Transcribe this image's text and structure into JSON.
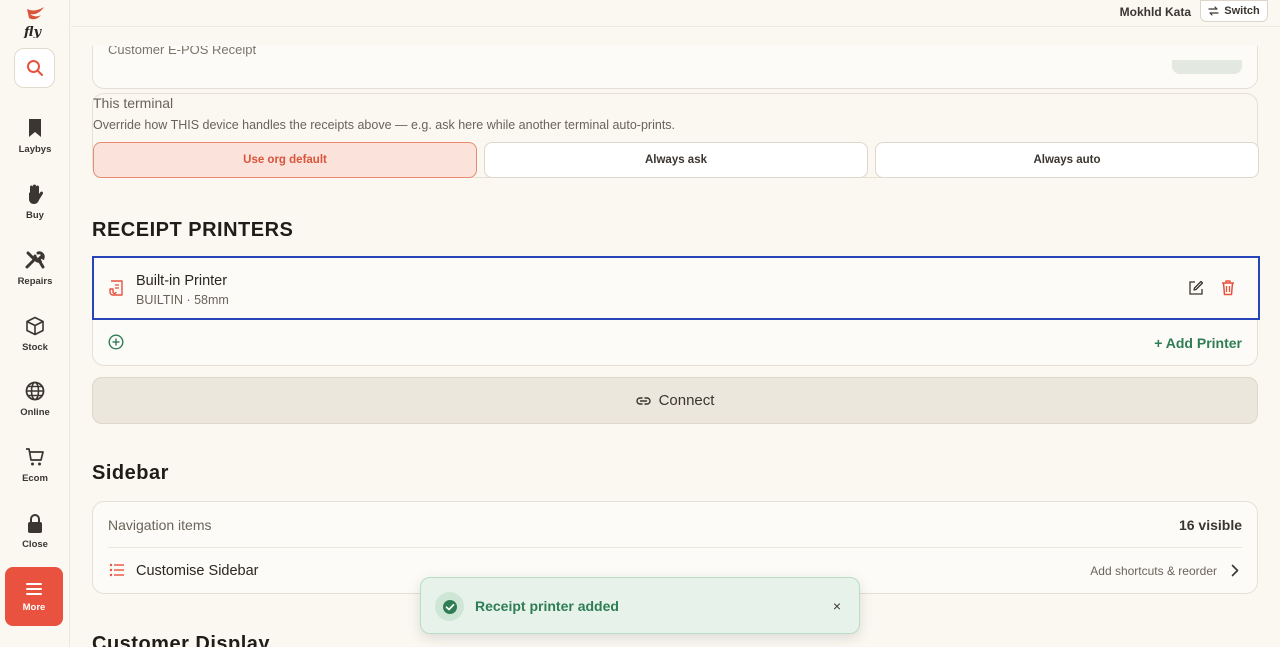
{
  "app": {
    "logo_text": "fly"
  },
  "topbar": {
    "user_name": "Mokhld Kata",
    "switch_label": "Switch"
  },
  "rail": {
    "items": [
      {
        "label": "Laybys",
        "icon": "bookmark-icon"
      },
      {
        "label": "Buy",
        "icon": "hand-icon"
      },
      {
        "label": "Repairs",
        "icon": "tools-icon"
      },
      {
        "label": "Stock",
        "icon": "box-icon"
      },
      {
        "label": "Online",
        "icon": "globe-icon"
      },
      {
        "label": "Ecom",
        "icon": "cart-icon"
      },
      {
        "label": "Close",
        "icon": "lock-icon"
      }
    ],
    "more_label": "More"
  },
  "partial_card": {
    "text": "Customer E-POS Receipt"
  },
  "terminal": {
    "title": "This terminal",
    "description": "Override how THIS device handles the receipts above — e.g. ask here while another terminal auto-prints.",
    "options": [
      "Use org default",
      "Always ask",
      "Always auto"
    ],
    "selected": "Use org default"
  },
  "printers": {
    "section_title": "RECEIPT PRINTERS",
    "items": [
      {
        "name": "Built-in Printer",
        "meta": "BUILTIN · 58mm"
      }
    ],
    "add_label": "+ Add Printer",
    "connect_label": "Connect"
  },
  "sidebar": {
    "section_title": "Sidebar",
    "nav_label": "Navigation items",
    "nav_count": "16 visible",
    "customise_label": "Customise Sidebar",
    "customise_hint": "Add shortcuts & reorder"
  },
  "next_section": {
    "title": "Customer Display"
  },
  "toast": {
    "message": "Receipt printer added",
    "close": "×"
  },
  "colors": {
    "accent": "#e8523f",
    "success": "#2f7d54",
    "focus": "#2744b8"
  }
}
